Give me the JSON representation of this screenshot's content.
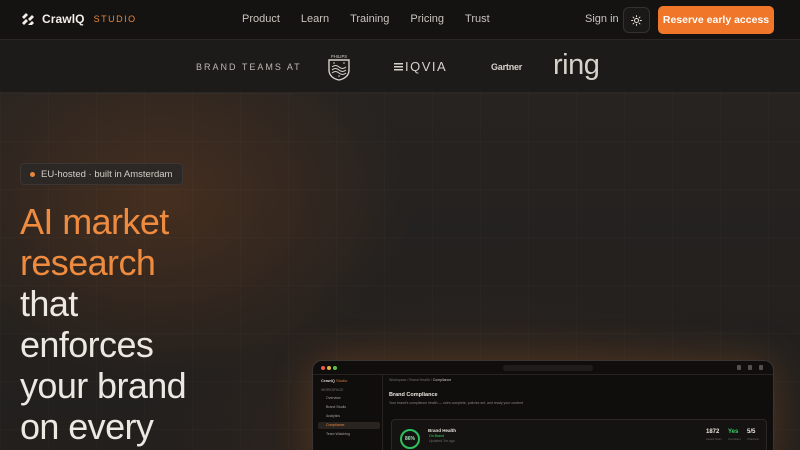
{
  "nav": {
    "logo_name": "CrawlQ",
    "logo_suffix": "STUDIO",
    "links": [
      "Product",
      "Learn",
      "Training",
      "Pricing",
      "Trust"
    ],
    "signin": "Sign in",
    "cta": "Reserve early access",
    "accent_color": "#f0762a"
  },
  "logos_strip": {
    "label": "BRAND TEAMS AT",
    "brands": [
      "PHILIPS",
      "IQVIA",
      "Gartner",
      "ring"
    ]
  },
  "hero": {
    "badge": "EU-hosted · built in Amsterdam",
    "headline_accent": [
      "AI market",
      "research"
    ],
    "headline_plain": [
      "that",
      "enforces",
      "your brand",
      "on every"
    ]
  },
  "app_preview": {
    "brand": "CrawlQ",
    "brand_suffix": "Studio",
    "sidebar_section": "WORKSPACE",
    "sidebar_items": [
      "Overview",
      "Brand Studio",
      "Analytics",
      "Compliance",
      "Team Watching"
    ],
    "breadcrumb_prefix": "Workspace / Brand Health /",
    "breadcrumb_current": "Compliance",
    "title": "Brand Compliance",
    "subtitle": "Your brand's compliance health — rules complete, policies set, and ready your content",
    "card": {
      "score": "86%",
      "title": "Brand Health",
      "status": "On Brand",
      "note": "Updated 2m ago",
      "stats": [
        {
          "value": "1872",
          "label": "Assets Scan"
        },
        {
          "value": "Yes",
          "label": "Compliant"
        },
        {
          "value": "5/5",
          "label": "Channels"
        }
      ]
    }
  }
}
